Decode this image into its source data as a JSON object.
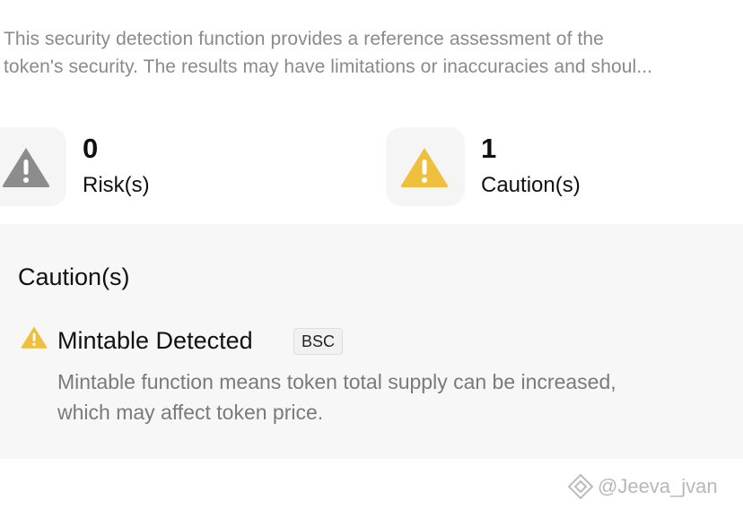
{
  "disclaimer": {
    "line1": "This security detection function provides a reference assessment of the",
    "line2": "token's security. The results may have limitations or inaccuracies and shoul..."
  },
  "summary": {
    "risks": {
      "count": "0",
      "label": "Risk(s)",
      "icon": "warning-triangle-gray-icon",
      "color": "#8c8c8c"
    },
    "cautions": {
      "count": "1",
      "label": "Caution(s)",
      "icon": "warning-triangle-yellow-icon",
      "color": "#f0c03c"
    }
  },
  "caution_panel": {
    "title": "Caution(s)",
    "items": [
      {
        "icon": "warning-triangle-yellow-icon",
        "title": "Mintable Detected",
        "chain": "BSC",
        "description_line1": "Mintable function means token total supply can be increased,",
        "description_line2": "which may affect token price."
      }
    ]
  },
  "watermark": {
    "text": "@Jeeva_jvan"
  }
}
